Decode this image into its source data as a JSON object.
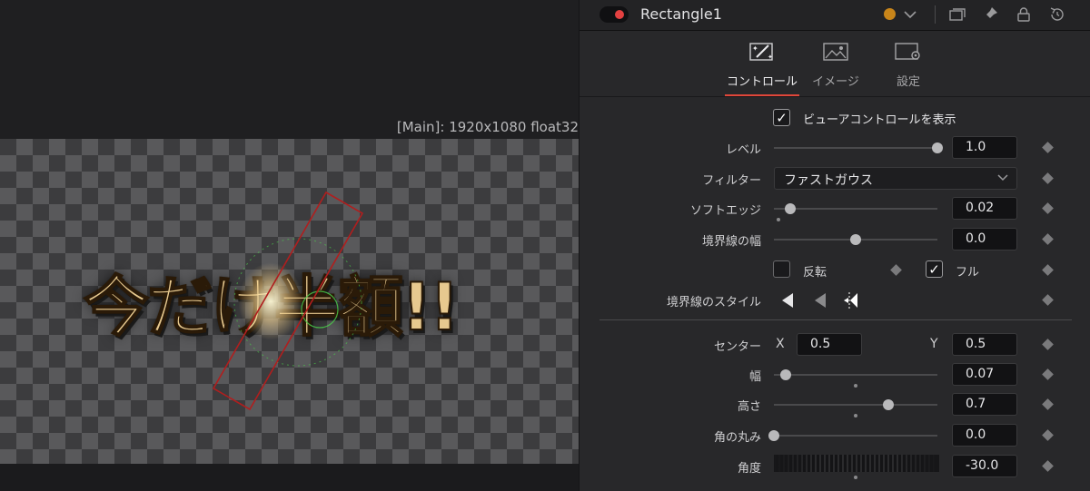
{
  "viewer": {
    "label": "[Main]: 1920x1080 float32",
    "canvas_text": "今だけ半額!!"
  },
  "inspector": {
    "node_title": "Rectangle1",
    "header_icons": [
      "node-color-dot",
      "chevron-down-icon",
      "windows-icon",
      "pin-icon",
      "lock-icon",
      "reset-icon"
    ],
    "tabs": [
      {
        "label": "コントロール",
        "icon": "controls-wand-icon",
        "active": true
      },
      {
        "label": "イメージ",
        "icon": "image-icon",
        "active": false
      },
      {
        "label": "設定",
        "icon": "settings-gear-icon",
        "active": false
      }
    ],
    "show_view_controls": {
      "label": "ビューアコントロールを表示",
      "checked": true
    },
    "level": {
      "label": "レベル",
      "value": "1.0",
      "fraction": 1.0
    },
    "filter": {
      "label": "フィルター",
      "value": "ファストガウス"
    },
    "soft_edge": {
      "label": "ソフトエッジ",
      "value": "0.02",
      "fraction": 0.1
    },
    "border_width": {
      "label": "境界線の幅",
      "value": "0.0",
      "fraction": 0.5
    },
    "invert": {
      "label": "反転",
      "checked": false
    },
    "solid": {
      "label": "フル",
      "checked": true
    },
    "border_style": {
      "label": "境界線のスタイル"
    },
    "center": {
      "label": "センター",
      "x_label": "X",
      "x_value": "0.5",
      "y_label": "Y",
      "y_value": "0.5"
    },
    "width": {
      "label": "幅",
      "value": "0.07",
      "fraction": 0.07
    },
    "height": {
      "label": "高さ",
      "value": "0.7",
      "fraction": 0.7
    },
    "corner_radius": {
      "label": "角の丸み",
      "value": "0.0",
      "fraction": 0.0
    },
    "angle": {
      "label": "角度",
      "value": "-30.0"
    },
    "colors": {
      "accent": "#e0473a",
      "node_dot": "#c8851a",
      "toggle_red": "#e34141"
    }
  }
}
